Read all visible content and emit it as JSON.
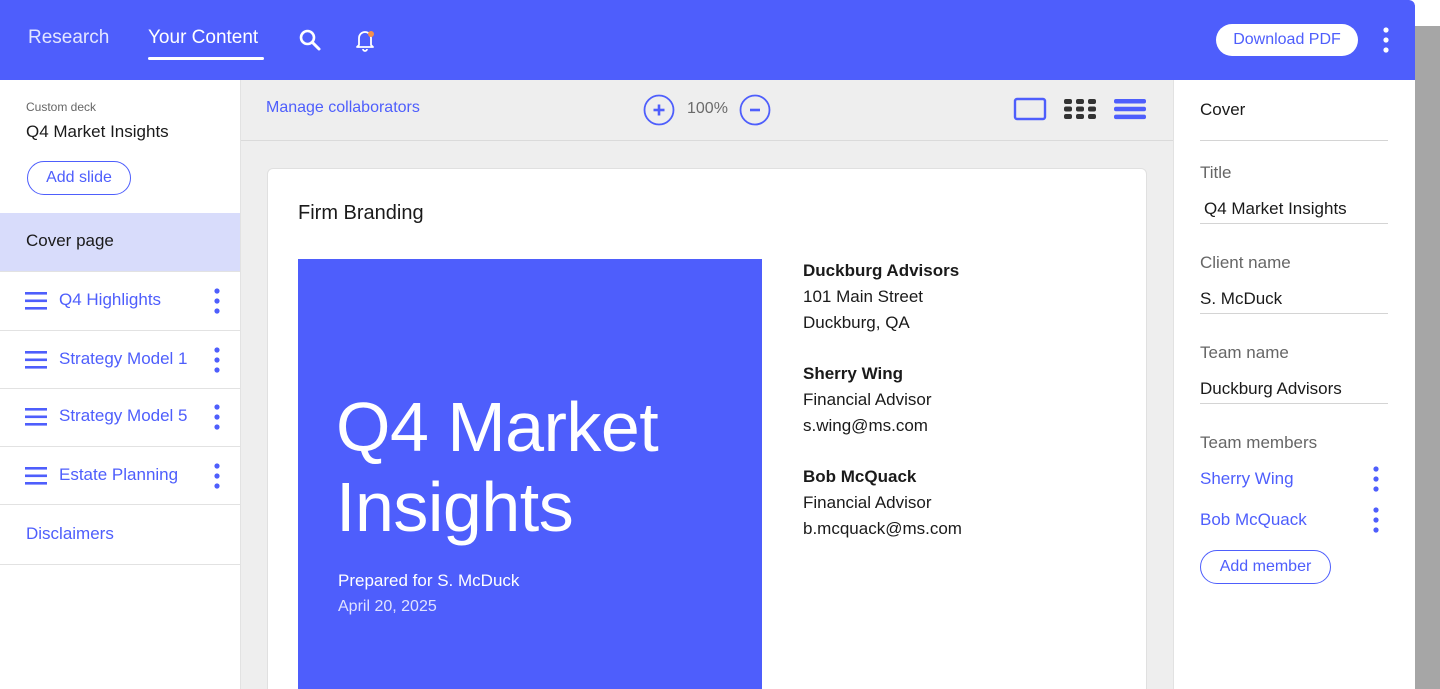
{
  "colors": {
    "brand": "#4e5efc",
    "active_bg": "#d8dcfb",
    "notification_dot": "#f5904a"
  },
  "header": {
    "nav": [
      {
        "label": "Research"
      },
      {
        "label": "Your Content"
      }
    ],
    "download_label": "Download PDF",
    "icons": [
      "search-icon",
      "bell-icon",
      "more-vertical-icon"
    ]
  },
  "sidebar": {
    "deck_label": "Custom deck",
    "deck_title": "Q4 Market Insights",
    "add_slide_label": "Add slide",
    "items": [
      {
        "label": "Cover page"
      },
      {
        "label": "Q4 Highlights"
      },
      {
        "label": "Strategy Model 1"
      },
      {
        "label": "Strategy Model 5"
      },
      {
        "label": "Estate Planning"
      },
      {
        "label": "Disclaimers"
      }
    ]
  },
  "toolbar": {
    "manage_label": "Manage collaborators",
    "zoom": "100%",
    "view_icons": [
      "single-view-icon",
      "grid-view-icon",
      "list-view-icon"
    ]
  },
  "slide": {
    "section_title": "Firm Branding",
    "cover_title": "Q4 Market Insights",
    "prepared_for": "Prepared for S. McDuck",
    "date": "April 20, 2025",
    "firm": {
      "name": "Duckburg Advisors",
      "line1": "101 Main Street",
      "line2": "Duckburg, QA"
    },
    "contacts": [
      {
        "name": "Sherry Wing",
        "role": "Financial Advisor",
        "email": "s.wing@ms.com"
      },
      {
        "name": "Bob McQuack",
        "role": "Financial Advisor",
        "email": "b.mcquack@ms.com"
      }
    ]
  },
  "panel": {
    "heading": "Cover",
    "title_label": "Title",
    "title_value": "Q4 Market Insights",
    "client_label": "Client name",
    "client_value": "S. McDuck",
    "team_label": "Team name",
    "team_value": "Duckburg Advisors",
    "members_label": "Team members",
    "members": [
      {
        "name": "Sherry Wing"
      },
      {
        "name": "Bob McQuack"
      }
    ],
    "add_member_label": "Add member"
  }
}
